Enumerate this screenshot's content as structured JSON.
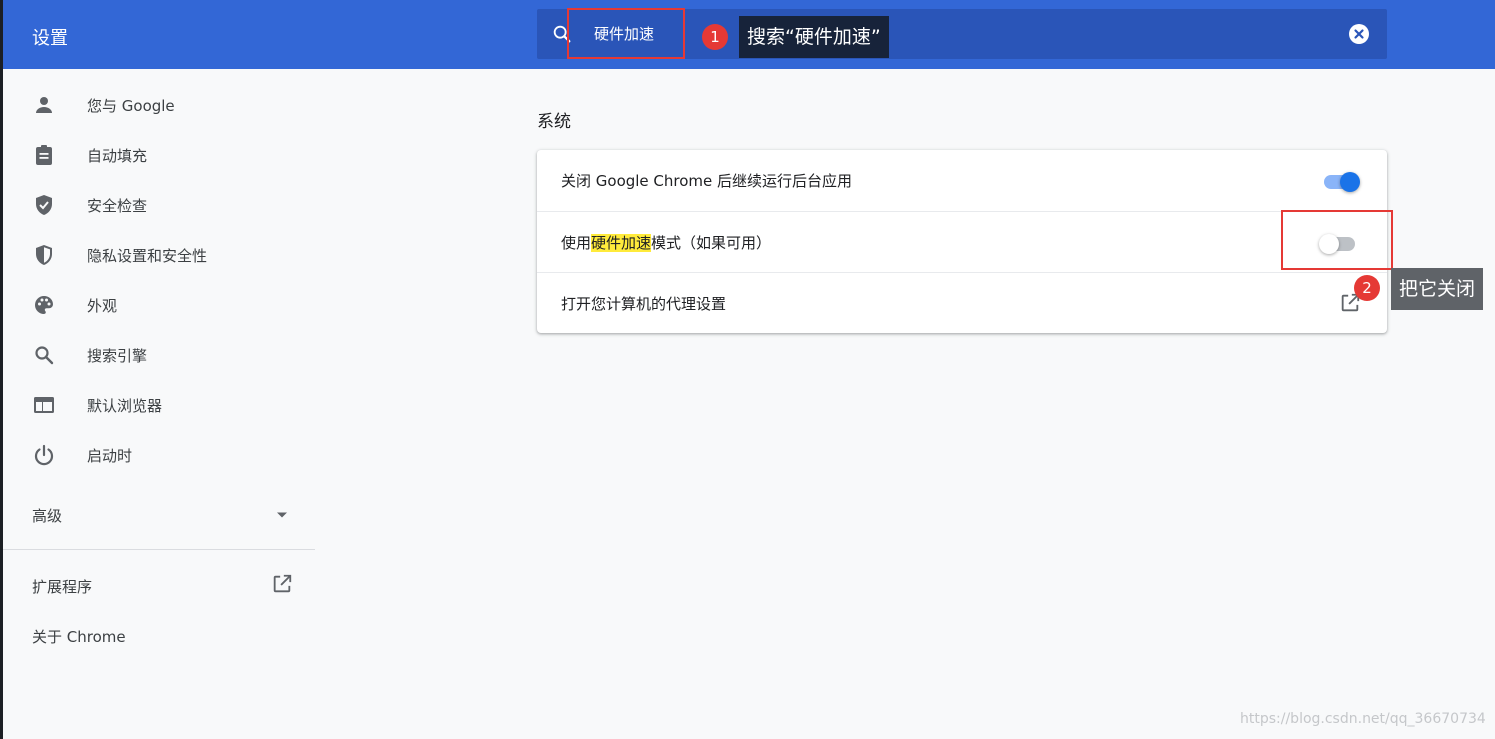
{
  "header": {
    "title": "设置",
    "search": {
      "value": "硬件加速",
      "search_icon": "search-icon",
      "clear_icon": "close-icon"
    }
  },
  "sidebar": {
    "items": [
      {
        "label": "您与 Google",
        "icon": "person-icon"
      },
      {
        "label": "自动填充",
        "icon": "clipboard-icon"
      },
      {
        "label": "安全检查",
        "icon": "shield-check-icon"
      },
      {
        "label": "隐私设置和安全性",
        "icon": "shield-half-icon"
      },
      {
        "label": "外观",
        "icon": "palette-icon"
      },
      {
        "label": "搜索引擎",
        "icon": "search-icon"
      },
      {
        "label": "默认浏览器",
        "icon": "browser-icon"
      },
      {
        "label": "启动时",
        "icon": "power-icon"
      }
    ],
    "advanced": "高级",
    "extensions": "扩展程序",
    "about": "关于 Chrome"
  },
  "main": {
    "section_title": "系统",
    "rows": [
      {
        "label": "关闭 Google Chrome 后继续运行后台应用",
        "toggle": true
      },
      {
        "label_pre": "使用",
        "label_hl": "硬件加速",
        "label_post": "模式（如果可用）",
        "toggle": false
      },
      {
        "label": "打开您计算机的代理设置",
        "icon": "open-in-new-icon"
      }
    ]
  },
  "annotations": [
    {
      "number": "1",
      "text": "搜索“硬件加速”"
    },
    {
      "number": "2",
      "text": "把它关闭"
    }
  ],
  "watermark": "https://blog.csdn.net/qq_36670734",
  "colors": {
    "header_bg": "#3367d6",
    "searchbox_bg": "#2a55b8",
    "toggle_on": "#1a73e8",
    "highlight": "#ffeb3b",
    "annotation_red": "#e53935"
  }
}
